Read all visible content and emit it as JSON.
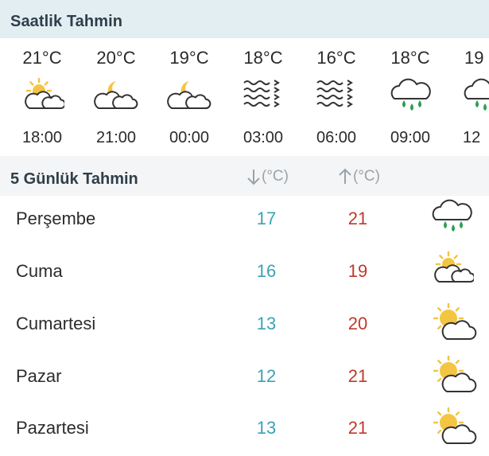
{
  "hourly": {
    "title": "Saatlik Tahmin",
    "items": [
      {
        "temp": "21°C",
        "time": "18:00",
        "icon": "sun-cloud-icon"
      },
      {
        "temp": "20°C",
        "time": "21:00",
        "icon": "moon-cloud-icon"
      },
      {
        "temp": "19°C",
        "time": "00:00",
        "icon": "moon-cloud-icon"
      },
      {
        "temp": "18°C",
        "time": "03:00",
        "icon": "fog-icon"
      },
      {
        "temp": "16°C",
        "time": "06:00",
        "icon": "fog-icon"
      },
      {
        "temp": "18°C",
        "time": "09:00",
        "icon": "rain-cloud-icon"
      },
      {
        "temp": "19",
        "time": "12",
        "icon": "rain-cloud-icon"
      }
    ]
  },
  "daily": {
    "title": "5 Günlük Tahmin",
    "min_header": "(°C)",
    "max_header": "(°C)",
    "days": [
      {
        "name": "Perşembe",
        "min": "17",
        "max": "21",
        "icon": "rain-cloud-icon"
      },
      {
        "name": "Cuma",
        "min": "16",
        "max": "19",
        "icon": "sun-cloud-icon"
      },
      {
        "name": "Cumartesi",
        "min": "13",
        "max": "20",
        "icon": "sun-cloud-icon"
      },
      {
        "name": "Pazar",
        "min": "12",
        "max": "21",
        "icon": "sun-cloud-icon"
      },
      {
        "name": "Pazartesi",
        "min": "13",
        "max": "21",
        "icon": "sun-cloud-icon"
      }
    ]
  },
  "colors": {
    "min_temp": "#3aa3b6",
    "max_temp": "#c0392b",
    "sun": "#f4c542",
    "rain_drop": "#2e9e4f",
    "header_bg": "#e2eef2"
  }
}
